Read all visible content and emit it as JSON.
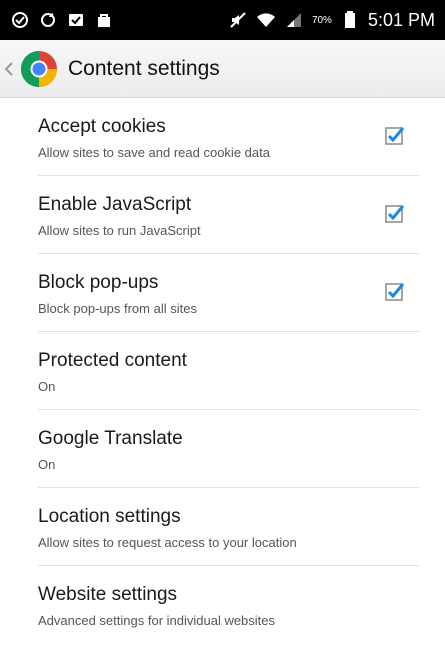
{
  "status_bar": {
    "battery_percent": "70%",
    "time": "5:01 PM"
  },
  "header": {
    "title": "Content settings"
  },
  "settings": [
    {
      "title": "Accept cookies",
      "subtitle": "Allow sites to save and read cookie data",
      "checked": true
    },
    {
      "title": "Enable JavaScript",
      "subtitle": "Allow sites to run JavaScript",
      "checked": true
    },
    {
      "title": "Block pop-ups",
      "subtitle": "Block pop-ups from all sites",
      "checked": true
    },
    {
      "title": "Protected content",
      "subtitle": "On"
    },
    {
      "title": "Google Translate",
      "subtitle": "On"
    },
    {
      "title": "Location settings",
      "subtitle": "Allow sites to request access to your location"
    },
    {
      "title": "Website settings",
      "subtitle": "Advanced settings for individual websites"
    }
  ],
  "colors": {
    "checkbox": "#1e88e5",
    "status_bar": "#000000"
  }
}
